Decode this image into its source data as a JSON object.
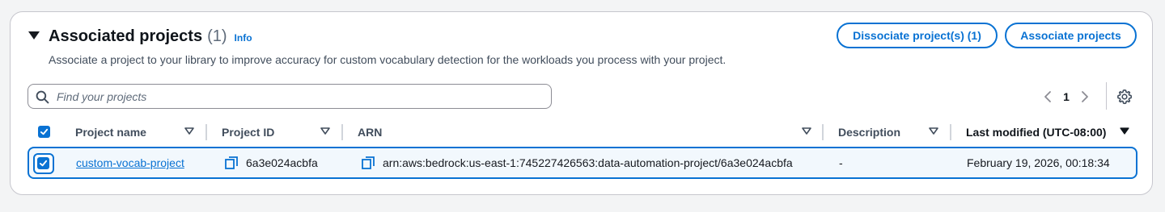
{
  "section": {
    "title": "Associated projects",
    "count": "(1)",
    "info_label": "Info",
    "description": "Associate a project to your library to improve accuracy for custom vocabulary detection for the workloads you process with your project."
  },
  "actions": {
    "dissociate_label": "Dissociate project(s) (1)",
    "associate_label": "Associate projects"
  },
  "search": {
    "placeholder": "Find your projects",
    "value": ""
  },
  "pagination": {
    "current_page": "1"
  },
  "table": {
    "columns": [
      {
        "label": "Project name"
      },
      {
        "label": "Project ID"
      },
      {
        "label": "ARN"
      },
      {
        "label": "Description"
      },
      {
        "label": "Last modified (UTC-08:00)"
      }
    ],
    "header_checked": true,
    "rows": [
      {
        "selected": true,
        "project_name": "custom-vocab-project",
        "project_id": "6a3e024acbfa",
        "arn": "arn:aws:bedrock:us-east-1:745227426563:data-automation-project/6a3e024acbfa",
        "description": "-",
        "last_modified": "February 19, 2026, 00:18:34"
      }
    ]
  },
  "icons": {
    "caret": "caret-down-filled-icon",
    "search": "search-icon",
    "prev": "chevron-left-icon",
    "next": "chevron-right-icon",
    "settings": "gear-icon",
    "sort": "caret-down-icon",
    "copy": "copy-icon",
    "check": "checkmark-icon"
  },
  "colors": {
    "accent": "#0972d3",
    "selected_row_bg": "#f2f8fd",
    "border": "#c6c6cd",
    "text": "#16191f"
  }
}
